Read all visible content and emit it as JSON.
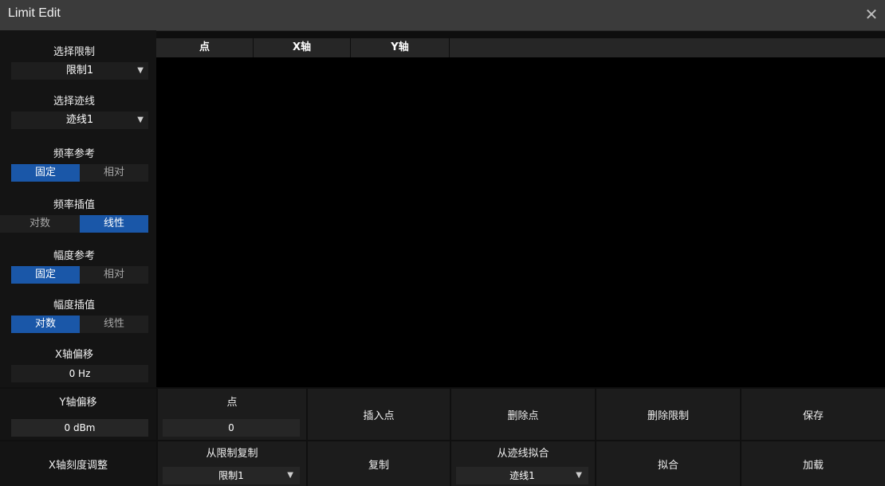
{
  "window": {
    "title": "Limit Edit",
    "close_symbol": "✕"
  },
  "left_panel": {
    "select_limit": {
      "label": "选择限制",
      "value": "限制1"
    },
    "select_trace": {
      "label": "选择迹线",
      "value": "迹线1"
    },
    "freq_reference": {
      "label": "频率参考",
      "options": [
        "固定",
        "相对"
      ],
      "selected": "固定"
    },
    "freq_interpolation": {
      "label": "频率插值",
      "options": [
        "对数",
        "线性"
      ],
      "selected": "线性"
    },
    "amp_reference": {
      "label": "幅度参考",
      "options": [
        "固定",
        "相对"
      ],
      "selected": "固定"
    },
    "amp_interpolation": {
      "label": "幅度插值",
      "options": [
        "对数",
        "线性"
      ],
      "selected": "对数"
    },
    "x_offset": {
      "label": "X轴偏移",
      "value": "0 Hz"
    },
    "y_offset": {
      "label": "Y轴偏移",
      "value": "0 dBm"
    },
    "x_scale_adjust": {
      "label": "X轴刻度调整"
    }
  },
  "table": {
    "columns": [
      "点",
      "X轴",
      "Y轴",
      ""
    ],
    "rows": []
  },
  "bottom": {
    "point": {
      "label": "点",
      "value": "0"
    },
    "insert_point": {
      "label": "插入点"
    },
    "delete_point": {
      "label": "删除点"
    },
    "delete_limit": {
      "label": "删除限制"
    },
    "save": {
      "label": "保存"
    },
    "copy_from_limit": {
      "label": "从限制复制",
      "value": "限制1"
    },
    "copy": {
      "label": "复制"
    },
    "fit_from_trace": {
      "label": "从迹线拟合",
      "value": "迹线1"
    },
    "fit": {
      "label": "拟合"
    },
    "load": {
      "label": "加载"
    }
  },
  "colors": {
    "accent": "#1a57a8",
    "background": "#0e0e0e",
    "titlebar": "#3b3b3b"
  },
  "icons": {
    "close": "close-icon",
    "dropdown": "triangle-down-icon"
  }
}
